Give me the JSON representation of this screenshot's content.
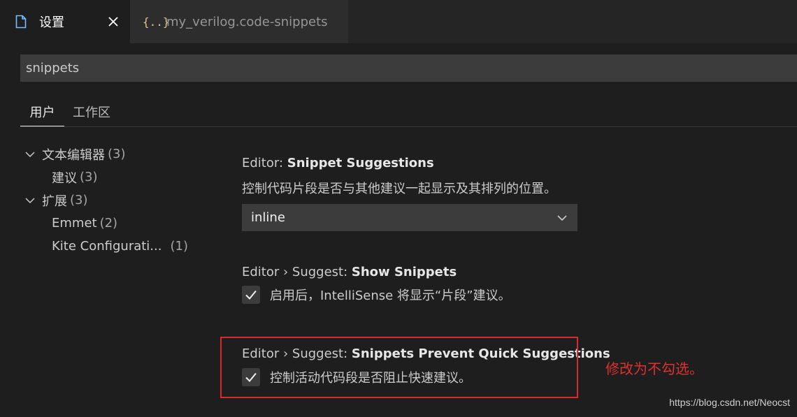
{
  "tabs": [
    {
      "label": "设置",
      "icon": "file-icon",
      "active": true
    },
    {
      "label": "my_verilog.code-snippets",
      "icon": "braces-json-icon",
      "active": false
    }
  ],
  "search": {
    "value": "snippets"
  },
  "scope_tabs": [
    {
      "label": "用户",
      "selected": true
    },
    {
      "label": "工作区",
      "selected": false
    }
  ],
  "toc": [
    {
      "label": "文本编辑器",
      "count": "(3)",
      "expanded": true
    },
    {
      "label": "建议",
      "count": "(3)"
    },
    {
      "label": "扩展",
      "count": "(3)",
      "expanded": true
    },
    {
      "label": "Emmet",
      "count": "(2)"
    },
    {
      "label": "Kite Configurati...",
      "count": "(1)"
    }
  ],
  "settings": {
    "snippet_suggestions": {
      "category": "Editor: ",
      "name": "Snippet Suggestions",
      "description": "控制代码片段是否与其他建议一起显示及其排列的位置。",
      "value": "inline"
    },
    "show_snippets": {
      "category": "Editor › Suggest: ",
      "name": "Show Snippets",
      "description": "启用后，IntelliSense 将显示“片段”建议。",
      "checked": true
    },
    "prevent_quick": {
      "category": "Editor › Suggest: ",
      "name": "Snippets Prevent Quick Suggestions",
      "description": "控制活动代码段是否阻止快速建议。",
      "checked": true
    }
  },
  "annotation": "修改为不勾选。",
  "watermark": "https://blog.csdn.net/Neocst",
  "colors": {
    "background": "#1e1e1e",
    "highlight_border": "#d82c2c",
    "annotation_text": "#e03030"
  }
}
